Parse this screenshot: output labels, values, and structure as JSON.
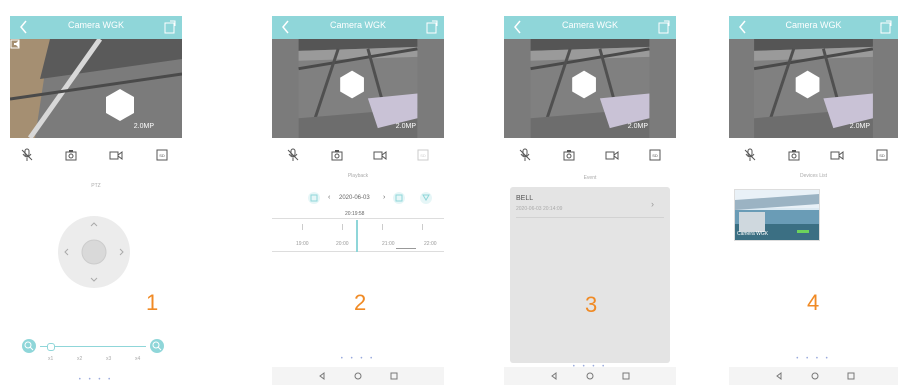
{
  "app": {
    "title": "Camera WGK",
    "resolution": "2.0MP"
  },
  "screens": [
    {
      "section": "PTZ",
      "number": "1",
      "zoom": {
        "levels": [
          "x1",
          "x2",
          "x3",
          "x4"
        ]
      }
    },
    {
      "section": "Playback",
      "number": "2",
      "date": "2020-06-03",
      "time_marker": "20:19:58",
      "timeline": [
        "19:00",
        "20:00",
        "21:00",
        "22:00"
      ]
    },
    {
      "section": "Event",
      "number": "3",
      "event": {
        "name": "BELL",
        "timestamp": "2020-06-03 20:14:09"
      }
    },
    {
      "section": "Devices List",
      "number": "4",
      "device": {
        "name": "Camera WGK"
      }
    }
  ],
  "page_dots": "• • • •",
  "colors": {
    "accent": "#8fd6d9",
    "number": "#f08a24"
  }
}
